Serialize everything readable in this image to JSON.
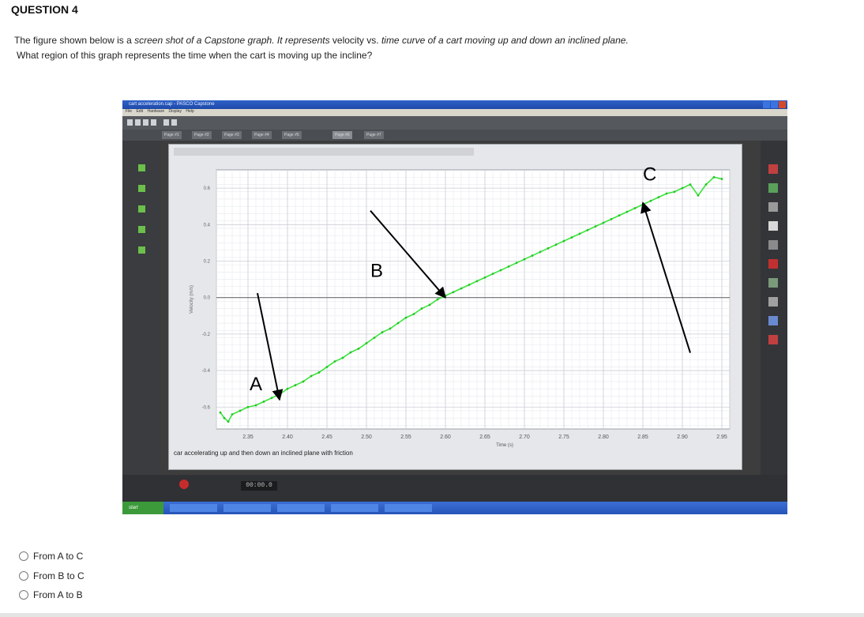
{
  "question": {
    "title": "QUESTION 4",
    "text_a": "The figure shown below is a ",
    "text_b": "screen shot of a Capstone graph. It  represents",
    "text_c": " velocity vs. ",
    "text_d": "time curve of a cart moving up and down an inclined plane.",
    "text_line2": "What region of this graph represents the time when the cart is moving up the incline?"
  },
  "screenshot": {
    "window_title": "cart acceleration.cap - PASCO Capstone",
    "menu": [
      "File",
      "Edit",
      "Hardware",
      "Display",
      "Help"
    ],
    "tabs": [
      "Page #1",
      "Page #2",
      "Page #3",
      "Page #4",
      "Page #5",
      "Page #6",
      "Page #7"
    ],
    "caption": "car accelerating up and then down an inclined plane with friction",
    "time_display": "00:00.0",
    "taskbar_start": "start",
    "colors": {
      "curve": "#39e639",
      "arrow": "#000000",
      "grid": "#c9ced6",
      "zero_line": "#6e6e6e"
    }
  },
  "chart_data": {
    "type": "line",
    "xlabel": "Time (s)",
    "ylabel": "Velocity (m/s)",
    "xlim": [
      2.31,
      2.96
    ],
    "ylim": [
      -0.72,
      0.7
    ],
    "x_ticks": [
      "2.35",
      "2.40",
      "2.45",
      "2.50",
      "2.55",
      "2.60",
      "2.65",
      "2.70",
      "2.75",
      "2.80",
      "2.85",
      "2.90",
      "2.95"
    ],
    "y_ticks": [
      "0.6",
      "0.4",
      "0.2",
      "0.0",
      "-0.2",
      "-0.4",
      "-0.6"
    ],
    "grid": true,
    "series": [
      {
        "x": [
          2.315,
          2.32,
          2.325,
          2.33,
          2.34,
          2.35,
          2.36,
          2.37,
          2.38,
          2.39,
          2.4,
          2.41,
          2.42,
          2.43,
          2.44,
          2.45,
          2.46,
          2.47,
          2.48,
          2.49,
          2.5,
          2.51,
          2.52,
          2.53,
          2.54,
          2.55,
          2.56,
          2.57,
          2.58,
          2.59,
          2.6,
          2.61,
          2.62,
          2.63,
          2.64,
          2.65,
          2.66,
          2.67,
          2.68,
          2.69,
          2.7,
          2.71,
          2.72,
          2.73,
          2.74,
          2.75,
          2.76,
          2.77,
          2.78,
          2.79,
          2.8,
          2.81,
          2.82,
          2.83,
          2.84,
          2.85,
          2.86,
          2.87,
          2.88,
          2.89,
          2.9,
          2.91,
          2.92,
          2.93,
          2.94,
          2.95
        ],
        "y": [
          -0.63,
          -0.66,
          -0.68,
          -0.64,
          -0.62,
          -0.6,
          -0.59,
          -0.57,
          -0.55,
          -0.53,
          -0.5,
          -0.48,
          -0.46,
          -0.43,
          -0.41,
          -0.38,
          -0.35,
          -0.33,
          -0.3,
          -0.28,
          -0.25,
          -0.22,
          -0.19,
          -0.17,
          -0.14,
          -0.11,
          -0.09,
          -0.06,
          -0.04,
          -0.01,
          0.01,
          0.03,
          0.05,
          0.07,
          0.09,
          0.11,
          0.13,
          0.15,
          0.17,
          0.19,
          0.21,
          0.23,
          0.25,
          0.27,
          0.29,
          0.31,
          0.33,
          0.35,
          0.37,
          0.39,
          0.41,
          0.43,
          0.45,
          0.47,
          0.49,
          0.51,
          0.53,
          0.55,
          0.57,
          0.58,
          0.6,
          0.62,
          0.56,
          0.62,
          0.66,
          0.65
        ]
      }
    ],
    "annotations": [
      {
        "label": "A",
        "point": [
          2.39,
          -0.56
        ]
      },
      {
        "label": "B",
        "point": [
          2.6,
          0.0
        ]
      },
      {
        "label": "C",
        "point": [
          2.85,
          0.52
        ]
      }
    ]
  },
  "options": [
    {
      "id": "opt-a-c",
      "label": "From A to C"
    },
    {
      "id": "opt-b-c",
      "label": "From B to C"
    },
    {
      "id": "opt-a-b",
      "label": "From A to B"
    }
  ]
}
